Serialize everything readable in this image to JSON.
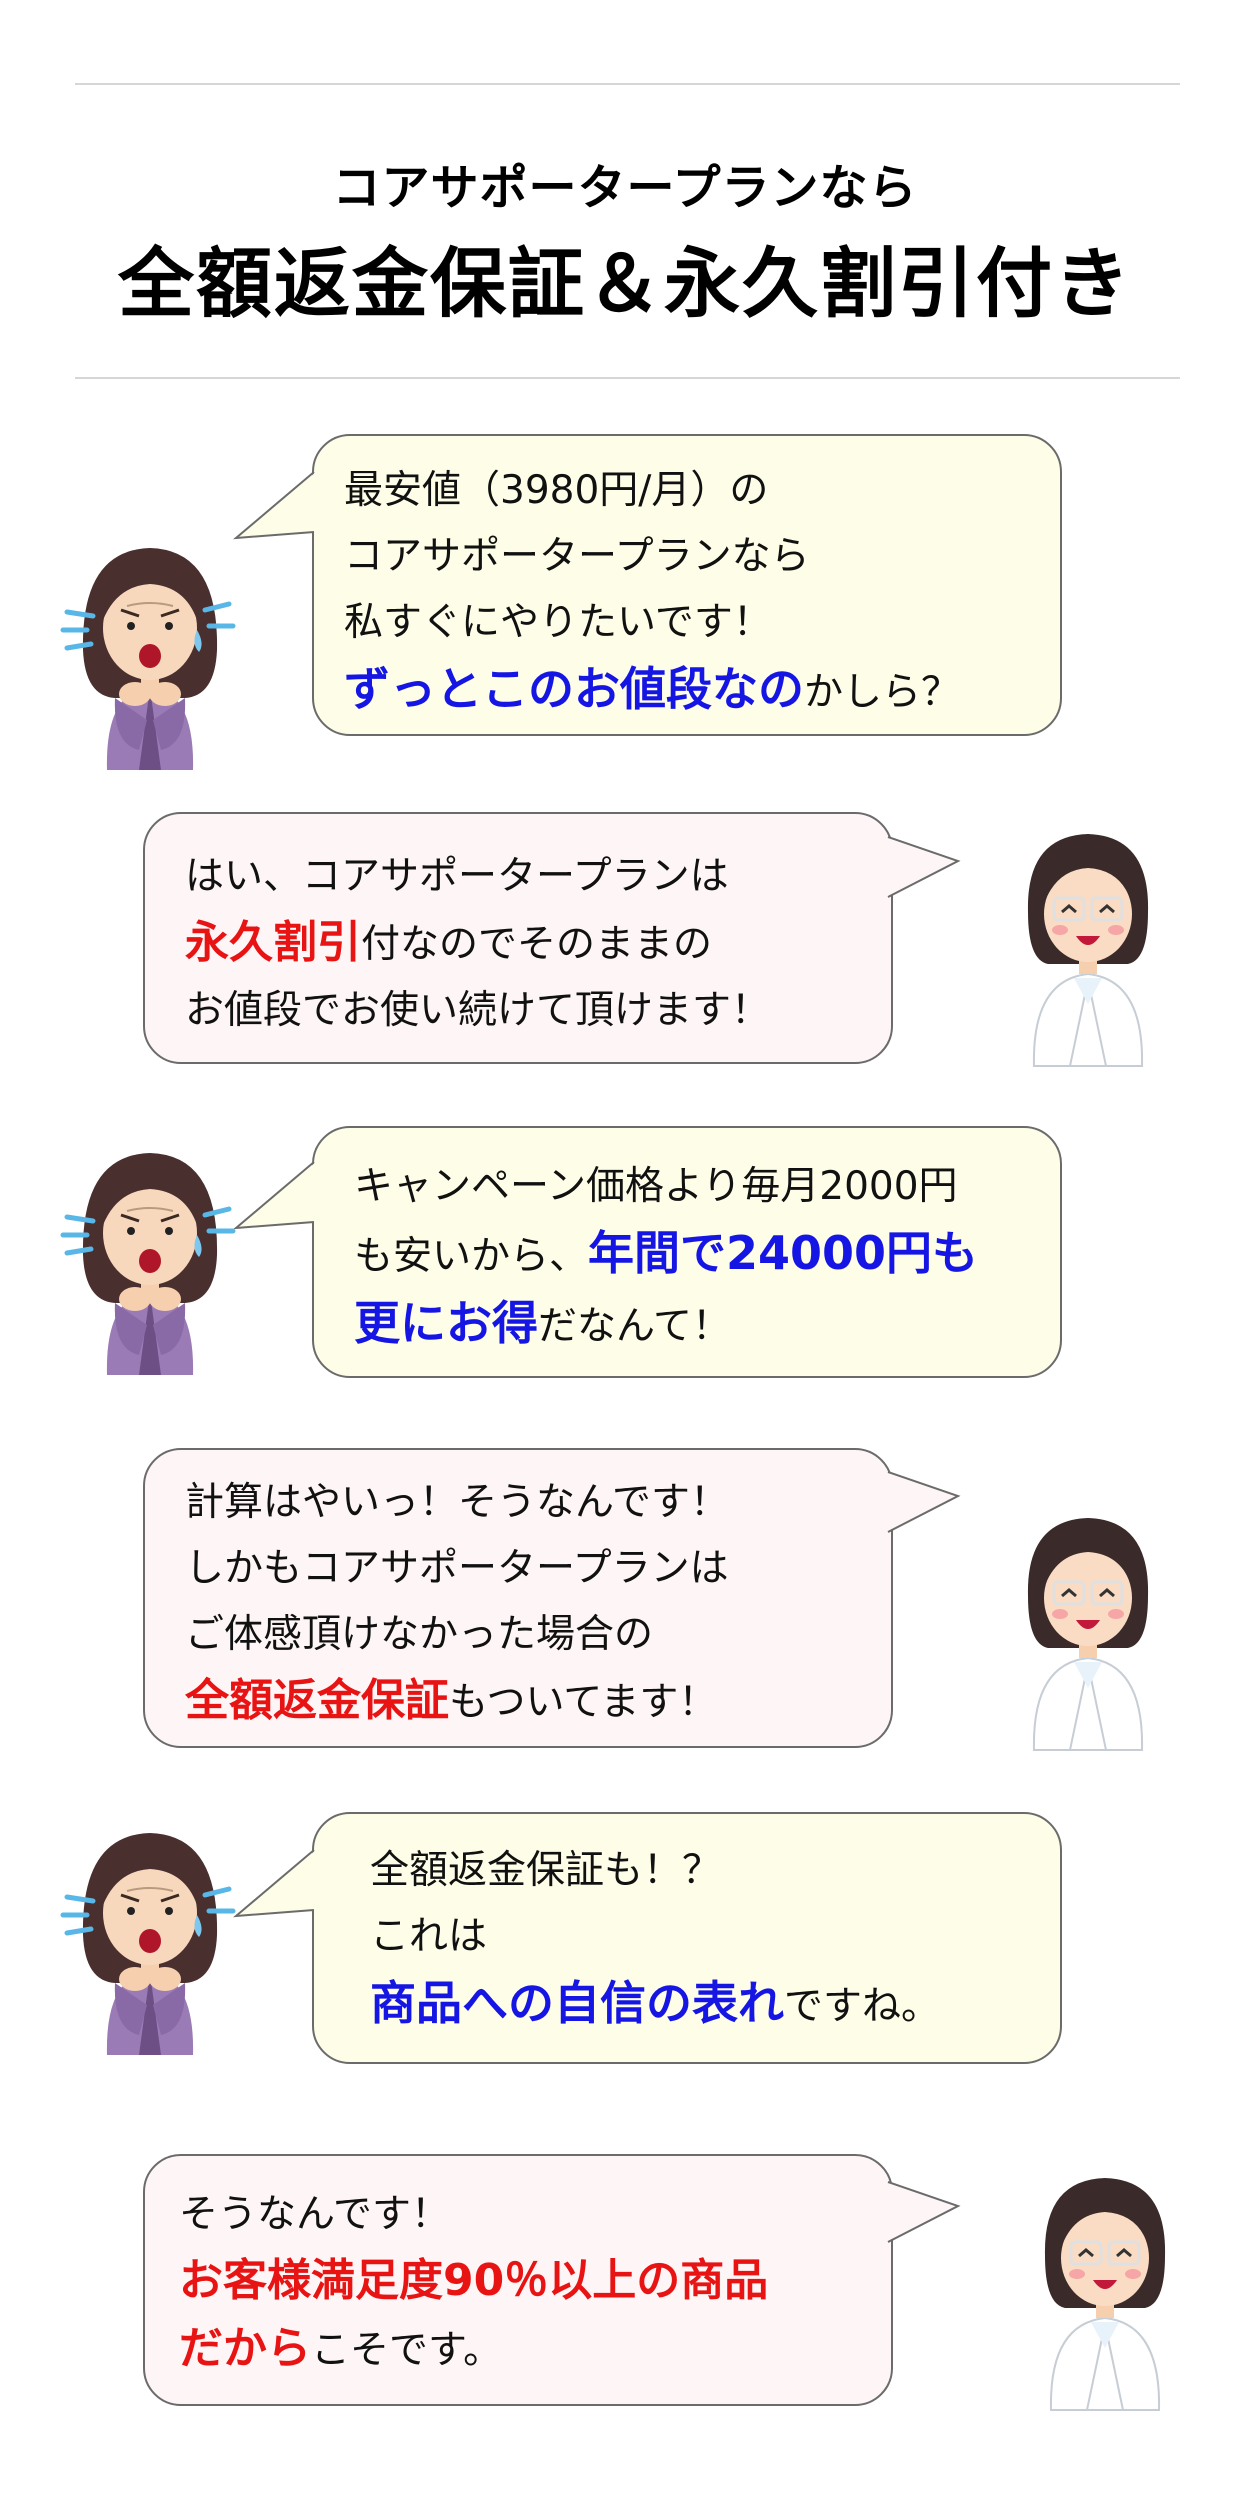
{
  "header": {
    "subtitle": "コアサポータープランなら",
    "title": "全額返金保証＆永久割引付き"
  },
  "dialogue": [
    {
      "speaker": "customer",
      "lines": [
        [
          {
            "t": "最安値（3980円/月）の"
          }
        ],
        [
          {
            "t": "コアサポータープランなら"
          }
        ],
        [
          {
            "t": "私すぐにやりたいです！"
          }
        ],
        [
          {
            "t": "ずっとこのお値段なの",
            "em": "blue"
          },
          {
            "t": "かしら？"
          }
        ]
      ]
    },
    {
      "speaker": "staff",
      "lines": [
        [
          {
            "t": "はい、コアサポータープランは"
          }
        ],
        [
          {
            "t": "永久割引",
            "em": "red"
          },
          {
            "t": "付なのでそのままの"
          }
        ],
        [
          {
            "t": "お値段でお使い続けて頂けます！"
          }
        ]
      ]
    },
    {
      "speaker": "customer",
      "lines": [
        [
          {
            "t": "キャンペーン価格より毎月2000円"
          }
        ],
        [
          {
            "t": "も安いから、"
          },
          {
            "t": "年間で24000円も",
            "em": "blue"
          }
        ],
        [
          {
            "t": "更にお得",
            "em": "blue"
          },
          {
            "t": "だなんて！"
          }
        ]
      ]
    },
    {
      "speaker": "staff",
      "lines": [
        [
          {
            "t": "計算はやいっ！そうなんです！"
          }
        ],
        [
          {
            "t": "しかもコアサポータープランは"
          }
        ],
        [
          {
            "t": "ご体感頂けなかった場合の"
          }
        ],
        [
          {
            "t": "全額返金保証",
            "em": "red"
          },
          {
            "t": "もついてます！"
          }
        ]
      ]
    },
    {
      "speaker": "customer",
      "lines": [
        [
          {
            "t": "全額返金保証も！？"
          }
        ],
        [
          {
            "t": "これは"
          }
        ],
        [
          {
            "t": "商品への自信の表れ",
            "em": "blue"
          },
          {
            "t": "ですね。"
          }
        ]
      ]
    },
    {
      "speaker": "staff",
      "lines": [
        [
          {
            "t": "そうなんです！"
          }
        ],
        [
          {
            "t": "お客様満足度90％以上の商品",
            "em": "red"
          }
        ],
        [
          {
            "t": "だから",
            "em": "red"
          },
          {
            "t": "こそです。"
          }
        ]
      ]
    }
  ],
  "icons": {
    "customer": "worried-woman-icon",
    "staff": "smiling-staff-icon"
  },
  "colors": {
    "emphasis_blue": "#1616e4",
    "emphasis_red": "#e81414",
    "customer_bubble": "#fefde8",
    "staff_bubble": "#fef6f6",
    "outline": "#6b6b6b"
  }
}
